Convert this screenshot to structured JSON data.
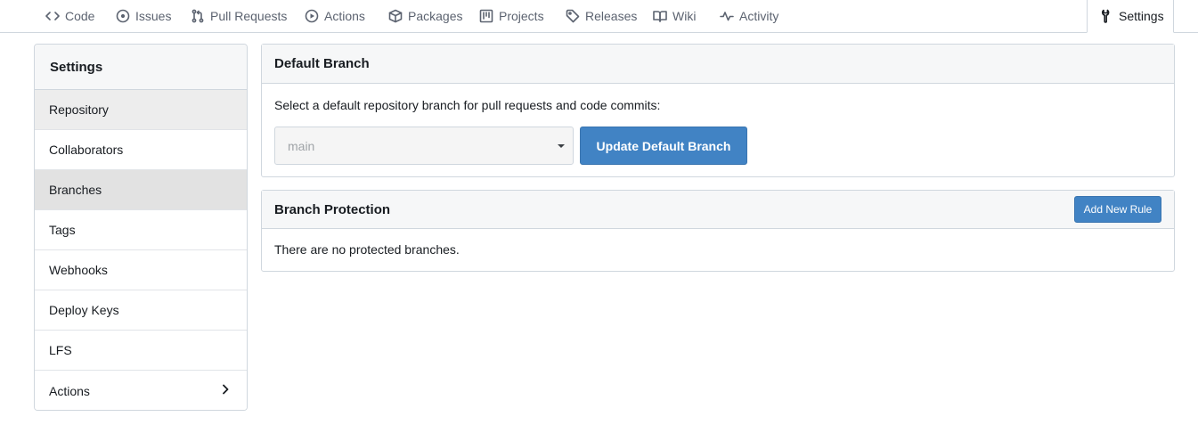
{
  "repo_nav": {
    "items": [
      {
        "label": "Code",
        "icon": "code-icon"
      },
      {
        "label": "Issues",
        "icon": "issue-icon"
      },
      {
        "label": "Pull Requests",
        "icon": "pull-request-icon"
      },
      {
        "label": "Actions",
        "icon": "play-icon"
      },
      {
        "label": "Packages",
        "icon": "package-icon"
      },
      {
        "label": "Projects",
        "icon": "project-icon"
      },
      {
        "label": "Releases",
        "icon": "tag-icon"
      },
      {
        "label": "Wiki",
        "icon": "book-icon"
      },
      {
        "label": "Activity",
        "icon": "pulse-icon"
      }
    ],
    "active": {
      "label": "Settings",
      "icon": "tools-icon"
    }
  },
  "sidebar": {
    "title": "Settings",
    "items": [
      {
        "label": "Repository"
      },
      {
        "label": "Collaborators"
      },
      {
        "label": "Branches"
      },
      {
        "label": "Tags"
      },
      {
        "label": "Webhooks"
      },
      {
        "label": "Deploy Keys"
      },
      {
        "label": "LFS"
      },
      {
        "label": "Actions"
      }
    ],
    "active_item": "Branches"
  },
  "default_branch": {
    "title": "Default Branch",
    "description": "Select a default repository branch for pull requests and code commits:",
    "selected_branch": "main",
    "update_button": "Update Default Branch"
  },
  "branch_protection": {
    "title": "Branch Protection",
    "add_rule_button": "Add New Rule",
    "empty_message": "There are no protected branches."
  },
  "colors": {
    "primary_button": "#4183c4",
    "border": "#d0d7de",
    "header_bg": "#f6f7f8",
    "active_sidebar_bg": "#e2e2e2"
  }
}
